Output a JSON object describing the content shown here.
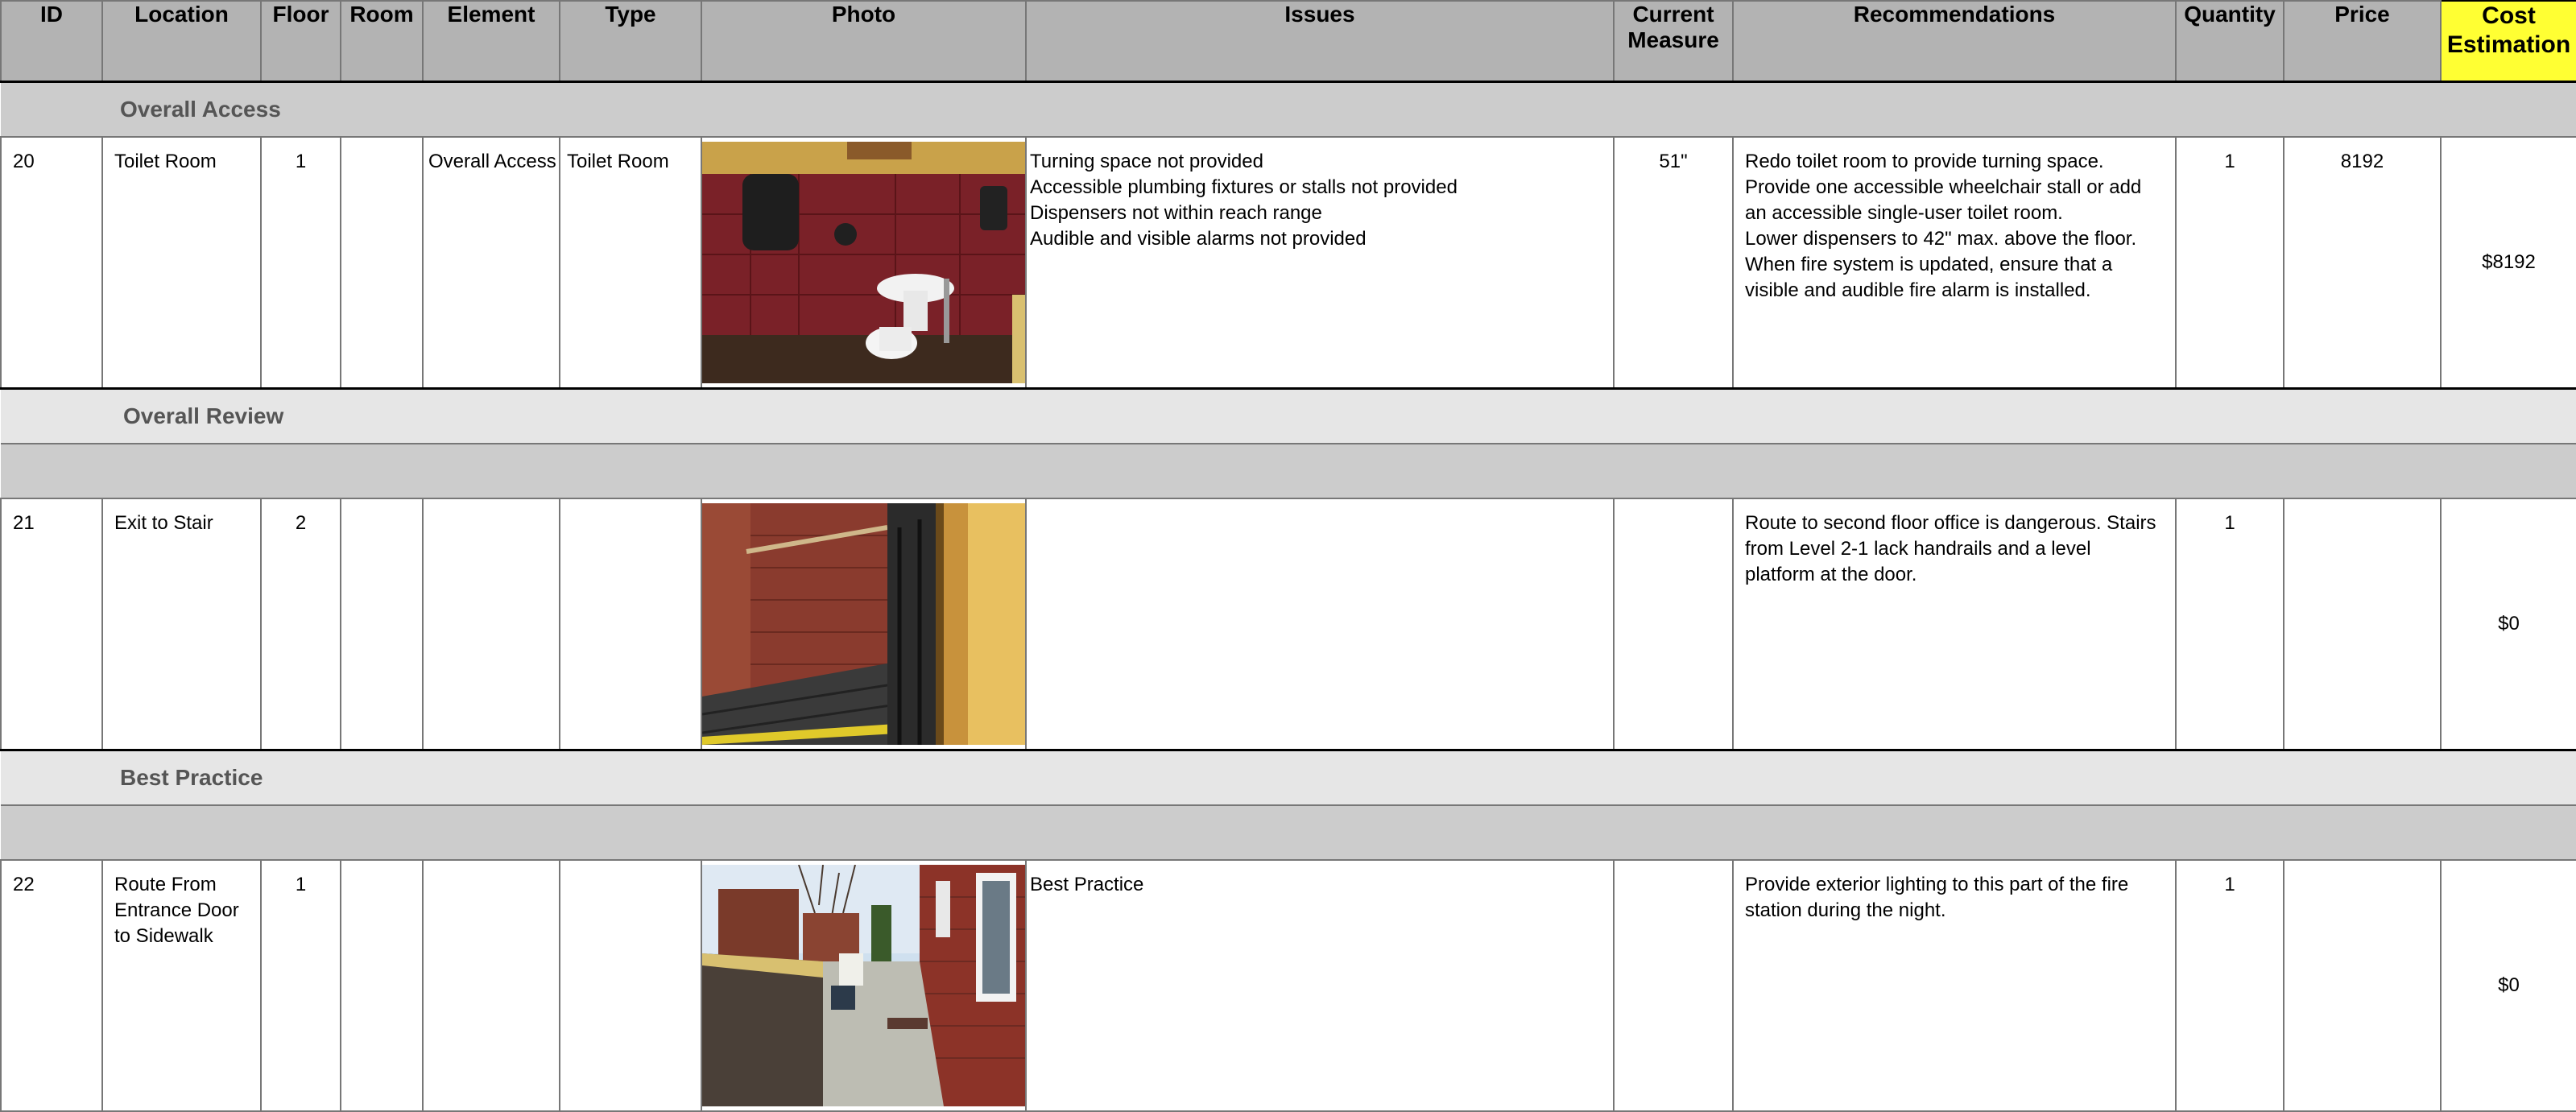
{
  "headers": {
    "id": "ID",
    "location": "Location",
    "floor": "Floor",
    "room": "Room",
    "element": "Element",
    "type": "Type",
    "photo": "Photo",
    "issues": "Issues",
    "current_measure_1": "Current",
    "current_measure_2": "Measure",
    "recommendations": "Recommendations",
    "quantity": "Quantity",
    "price": "Price",
    "cost_1": "Cost",
    "cost_2": "Estimation"
  },
  "sections": [
    {
      "label": "Overall Access",
      "row": {
        "id": "20",
        "location": "Toilet Room",
        "floor": "1",
        "room": "",
        "element": "Overall Access",
        "type": "Toilet Room",
        "photo": "toilet-room-photo",
        "issues": [
          "Turning space not provided",
          "Accessible plumbing fixtures or stalls not provided",
          "Dispensers not within reach range",
          "Audible and visible alarms not provided"
        ],
        "current_measure": "51\"",
        "recommendations": [
          "Redo toilet room to provide turning space.",
          "Provide one accessible wheelchair stall or add",
          "an accessible single-user toilet room.",
          "Lower dispensers to 42\" max. above the floor.",
          "When fire system is updated, ensure that a",
          "visible and audible fire alarm is installed."
        ],
        "quantity": "1",
        "price": "8192",
        "cost": "$8192"
      }
    },
    {
      "label": "Overall Review",
      "row": {
        "id": "21",
        "location": "Exit to Stair",
        "floor": "2",
        "room": "",
        "element": "",
        "type": "",
        "photo": "stair-photo",
        "issues": [],
        "current_measure": "",
        "recommendations": [
          "Route to second floor office is dangerous. Stairs",
          "from Level 2-1 lack handrails and a level",
          "platform at the door."
        ],
        "quantity": "1",
        "price": "",
        "cost": "$0"
      }
    },
    {
      "label": "Best Practice",
      "row": {
        "id": "22",
        "location": "Route From Entrance Door to Sidewalk",
        "floor": "1",
        "room": "",
        "element": "",
        "type": "",
        "photo": "exterior-walkway-photo",
        "issues": [
          "Best Practice"
        ],
        "current_measure": "",
        "recommendations": [
          "Provide exterior lighting to this part of the fire",
          "station during the night."
        ],
        "quantity": "1",
        "price": "",
        "cost": "$0"
      }
    }
  ],
  "colors": {
    "header_bg": "#b3b3b3",
    "cost_header_bg": "#ffff33",
    "section_bg": "#e6e6e6",
    "spacer_bg": "#cccccc"
  }
}
